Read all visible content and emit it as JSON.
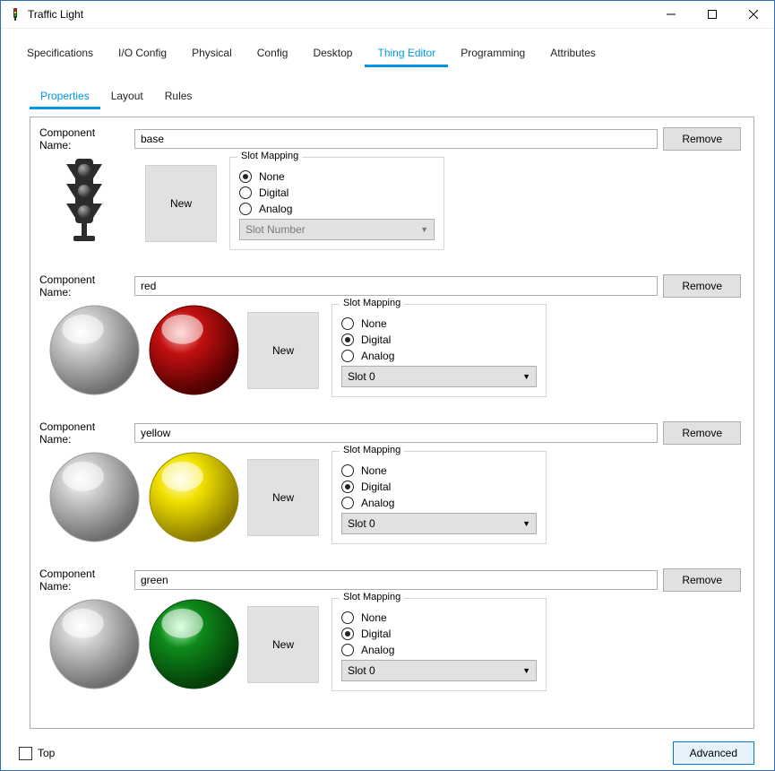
{
  "window": {
    "title": "Traffic Light"
  },
  "tabs": {
    "items": [
      {
        "label": "Specifications"
      },
      {
        "label": "I/O Config"
      },
      {
        "label": "Physical"
      },
      {
        "label": "Config"
      },
      {
        "label": "Desktop"
      },
      {
        "label": "Thing Editor"
      },
      {
        "label": "Programming"
      },
      {
        "label": "Attributes"
      }
    ],
    "active_index": 5
  },
  "subtabs": {
    "items": [
      {
        "label": "Properties"
      },
      {
        "label": "Layout"
      },
      {
        "label": "Rules"
      }
    ],
    "active_index": 0
  },
  "labels": {
    "component_name": "Component Name:",
    "remove": "Remove",
    "new": "New",
    "slot_mapping": "Slot Mapping",
    "none": "None",
    "digital": "Digital",
    "analog": "Analog",
    "slot_number_placeholder": "Slot Number",
    "slot0": "Slot 0",
    "top": "Top",
    "advanced": "Advanced"
  },
  "components": [
    {
      "name": "base",
      "slot_mapping": "None",
      "slot_select": {
        "enabled": false,
        "text": "Slot Number"
      },
      "visual": "traffic-light-icon",
      "spheres": []
    },
    {
      "name": "red",
      "slot_mapping": "Digital",
      "slot_select": {
        "enabled": true,
        "text": "Slot 0"
      },
      "visual": "spheres",
      "spheres": [
        "grey",
        "red"
      ]
    },
    {
      "name": "yellow",
      "slot_mapping": "Digital",
      "slot_select": {
        "enabled": true,
        "text": "Slot 0"
      },
      "visual": "spheres",
      "spheres": [
        "grey",
        "yellow"
      ]
    },
    {
      "name": "green",
      "slot_mapping": "Digital",
      "slot_select": {
        "enabled": true,
        "text": "Slot 0"
      },
      "visual": "spheres",
      "spheres": [
        "grey",
        "green"
      ]
    }
  ],
  "sphere_colors": {
    "grey": {
      "hi": "#ffffff",
      "mid": "#c8c8c8",
      "lo": "#6e6e6e",
      "rim": "#9a9a9a"
    },
    "red": {
      "hi": "#ffb3b3",
      "mid": "#c21010",
      "lo": "#4d0000",
      "rim": "#5c0000"
    },
    "yellow": {
      "hi": "#ffffe0",
      "mid": "#f2e200",
      "lo": "#8a7a00",
      "rim": "#9a8a00"
    },
    "green": {
      "hi": "#b6ffc2",
      "mid": "#0e8a1a",
      "lo": "#043d09",
      "rim": "#0a4a0f"
    }
  },
  "footer": {
    "top_checked": false
  }
}
